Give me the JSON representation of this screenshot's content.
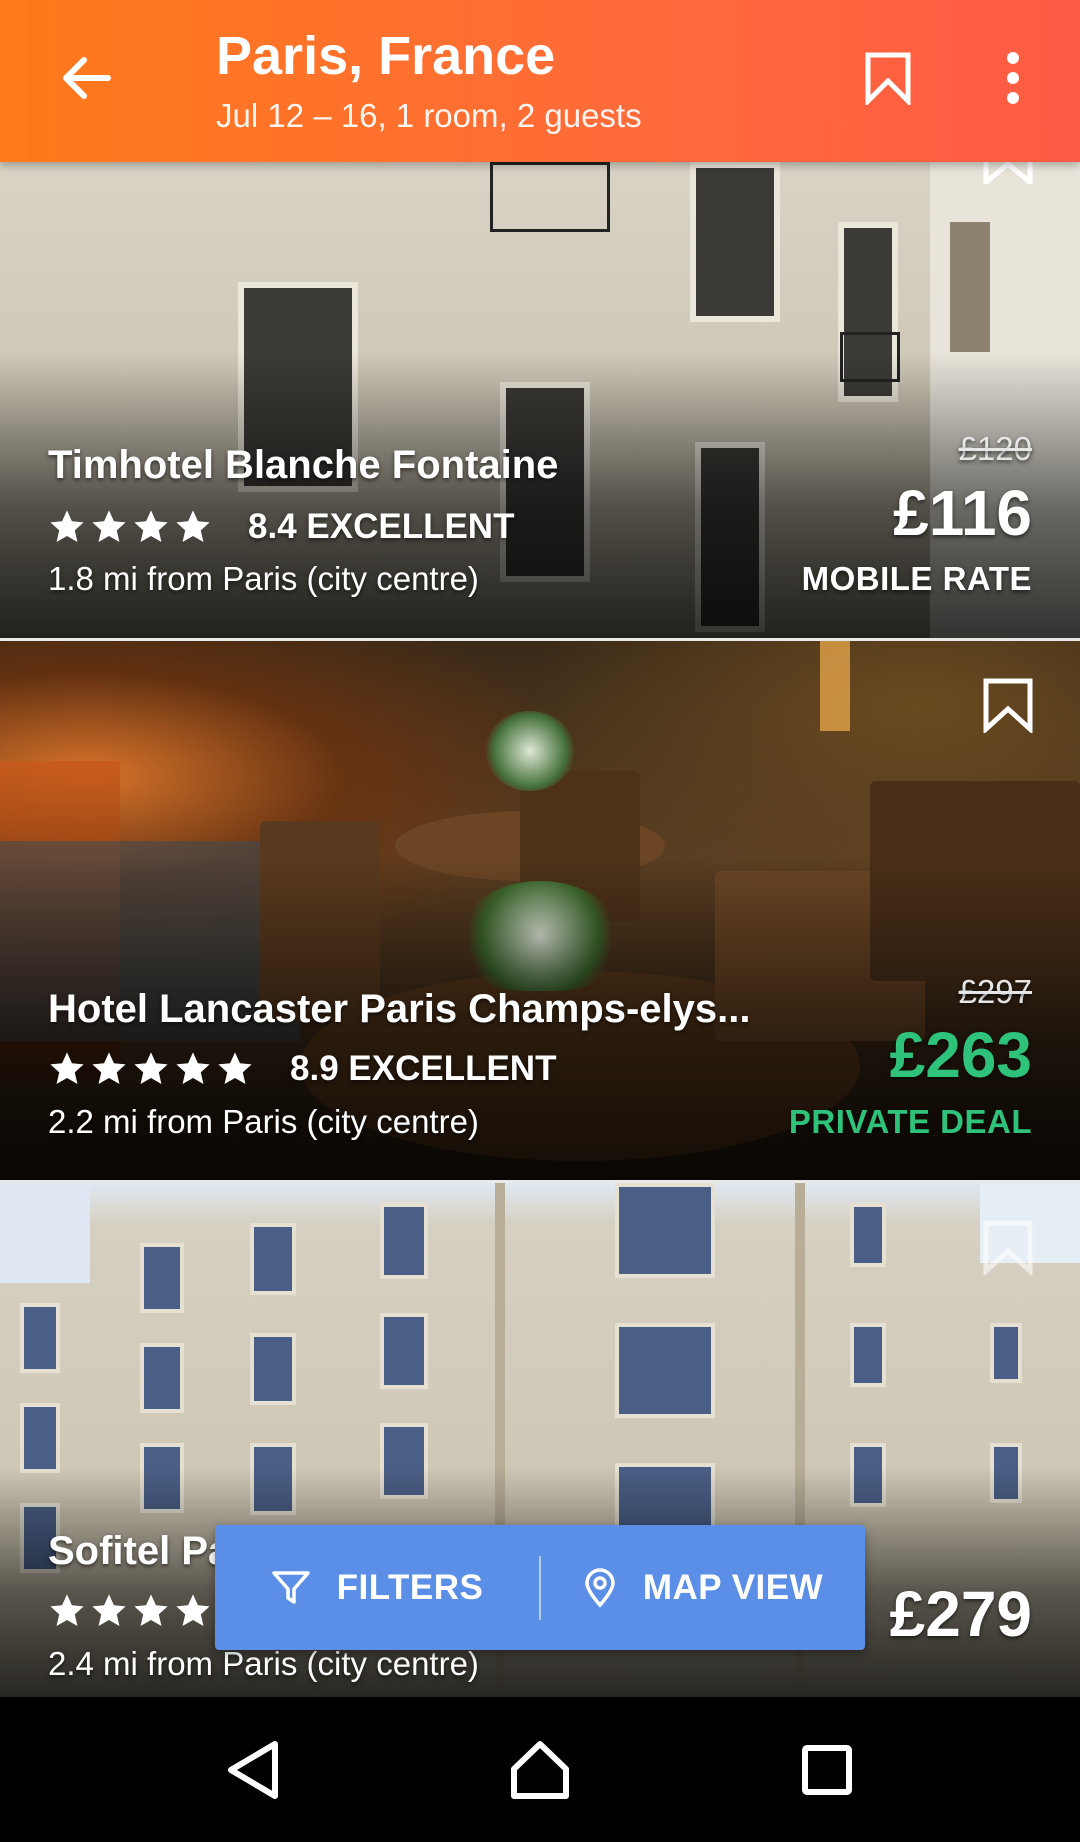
{
  "header": {
    "title": "Paris, France",
    "subtitle": "Jul 12 – 16, 1 room, 2 guests"
  },
  "hotels": [
    {
      "name": "Timhotel Blanche Fontaine",
      "stars": 4,
      "rating": "8.4 EXCELLENT",
      "distance": "1.8 mi from Paris (city centre)",
      "old_price": "£120",
      "price": "£116",
      "rate_label": "MOBILE RATE"
    },
    {
      "name": "Hotel Lancaster Paris Champs-elys...",
      "stars": 5,
      "rating": "8.9 EXCELLENT",
      "distance": "2.2 mi from Paris (city centre)",
      "old_price": "£297",
      "price": "£263",
      "rate_label": "PRIVATE DEAL"
    },
    {
      "name": "Sofitel Pa",
      "stars": 4,
      "distance": "2.4 mi from Paris (city centre)",
      "price": "£279"
    }
  ],
  "actions": {
    "filters_label": "FILTERS",
    "map_view_label": "MAP VIEW"
  },
  "colors": {
    "header_start": "#ff7a1a",
    "header_end": "#ff5a45",
    "action_bar": "#5b8ee6",
    "deal_green": "#2ec27a"
  },
  "icons": {
    "back": "arrow-left-icon",
    "bookmark": "bookmark-icon",
    "more": "more-vertical-icon",
    "filter": "filter-icon",
    "map": "map-pin-icon",
    "nav_back": "triangle-back-icon",
    "nav_home": "home-icon",
    "nav_recents": "square-recents-icon"
  }
}
